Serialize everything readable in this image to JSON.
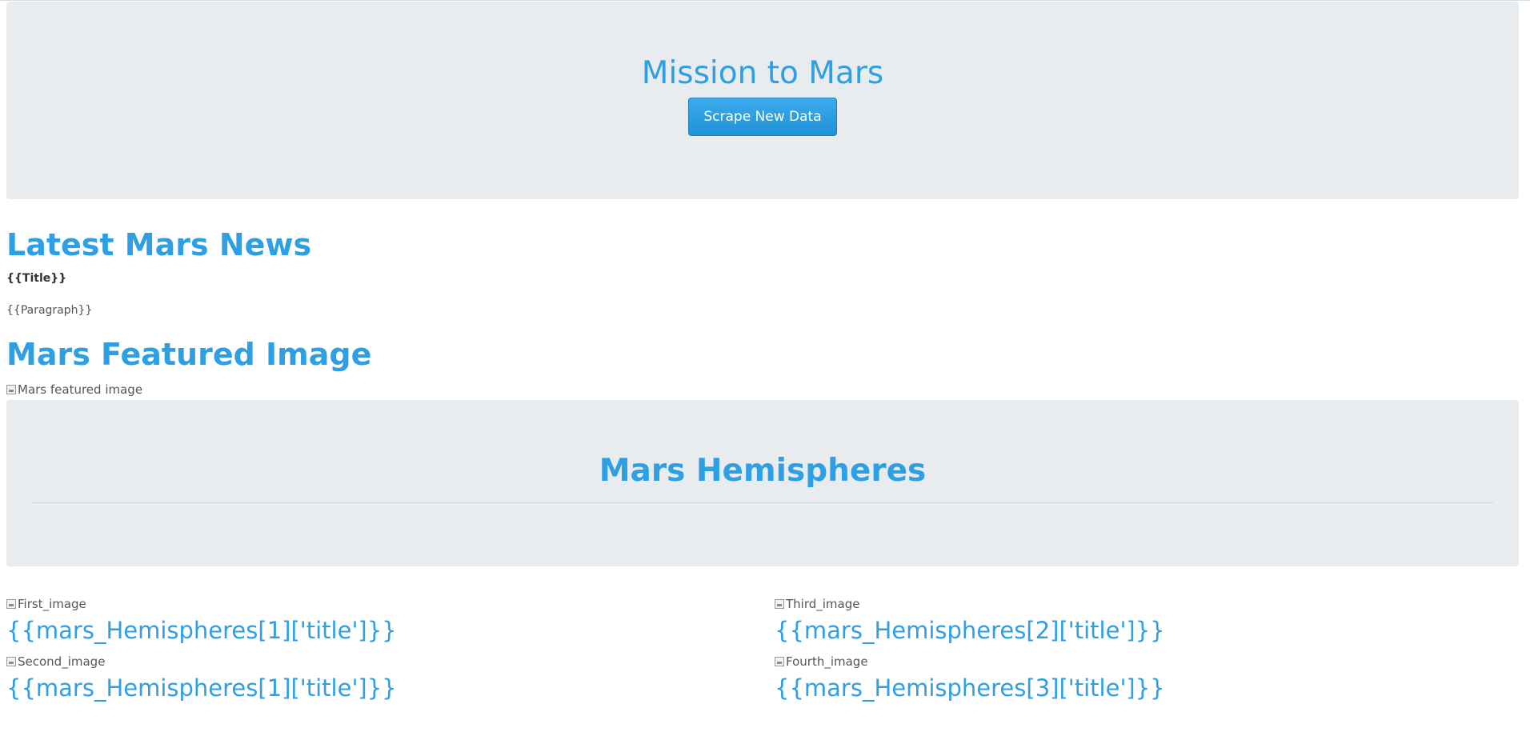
{
  "header": {
    "title": "Mission to Mars",
    "scrape_button_label": "Scrape New Data"
  },
  "news": {
    "heading": "Latest Mars News",
    "title": "{{Title}}",
    "paragraph": "{{Paragraph}}"
  },
  "featured": {
    "heading": "Mars Featured Image",
    "image_alt": "Mars featured image"
  },
  "hemispheres": {
    "heading": "Mars Hemispheres",
    "items": [
      {
        "image_alt": "First_image",
        "title": "{{mars_Hemispheres[1]['title']}}"
      },
      {
        "image_alt": "Second_image",
        "title": "{{mars_Hemispheres[1]['title']}}"
      },
      {
        "image_alt": "Third_image",
        "title": "{{mars_Hemispheres[2]['title']}}"
      },
      {
        "image_alt": "Fourth_image",
        "title": "{{mars_Hemispheres[3]['title']}}"
      }
    ]
  },
  "colors": {
    "accent": "#2e9fe3",
    "jumbotron_bg": "#e8ecef",
    "button_bg": "#2a9fe5"
  }
}
